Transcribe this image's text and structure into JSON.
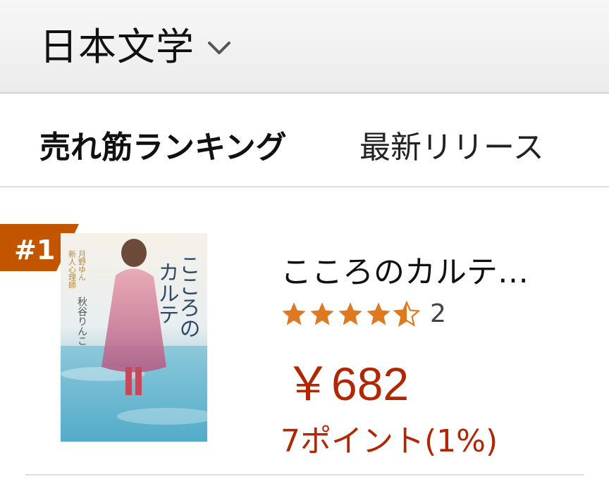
{
  "header": {
    "category": "日本文学"
  },
  "tabs": [
    {
      "label": "売れ筋ランキング",
      "active": true
    },
    {
      "label": "最新リリース",
      "active": false
    }
  ],
  "item": {
    "rank": "#1",
    "title": "こころのカルテ…",
    "rating": 4.5,
    "review_count": "2",
    "price": "￥682",
    "points": "7ポイント(1%)",
    "cover_texts": {
      "title_vertical": "こころのカルテ",
      "author": "秋谷りんこ",
      "series": "新人心理師・月野ゆん"
    }
  },
  "colors": {
    "price": "#b12704",
    "star": "#de7921",
    "badge": "#c45500"
  }
}
